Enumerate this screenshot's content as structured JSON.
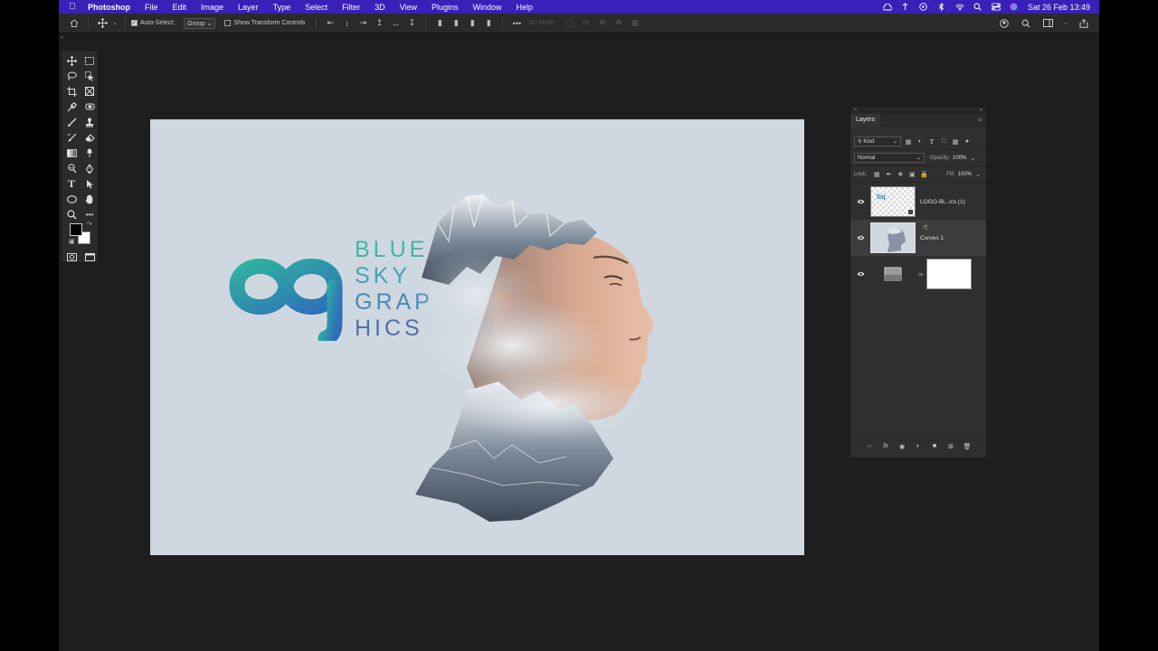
{
  "menubar": {
    "app_name": "Photoshop",
    "items": [
      "File",
      "Edit",
      "Image",
      "Layer",
      "Type",
      "Select",
      "Filter",
      "3D",
      "View",
      "Plugins",
      "Window",
      "Help"
    ],
    "clock": "Sat 26 Feb  13:49",
    "status_icons": [
      "creative-cloud-icon",
      "airdrop-icon",
      "play-icon",
      "bluetooth-icon",
      "wifi-icon",
      "search-icon",
      "control-center-icon",
      "siri-icon"
    ]
  },
  "options_bar": {
    "auto_select_label": "Auto-Select:",
    "auto_select_checked": true,
    "auto_select_mode": "Group",
    "show_transform_label": "Show Transform Controls",
    "show_transform_checked": false,
    "mode_3d_label": "3D Mode:"
  },
  "toolbar": {
    "tools": [
      "move-tool",
      "marquee-tool",
      "lasso-tool",
      "object-select-tool",
      "crop-tool",
      "frame-tool",
      "eyedropper-tool",
      "frame-rect-tool",
      "brush-tool",
      "stamp-tool",
      "history-brush-tool",
      "eraser-tool",
      "gradient-tool",
      "smudge-tool",
      "dodge-tool",
      "pen-tool",
      "type-tool",
      "path-select-tool",
      "ellipse-tool",
      "hand-tool",
      "zoom-tool",
      "more-tools"
    ],
    "foreground_color": "#000000",
    "background_color": "#ffffff"
  },
  "canvas": {
    "background": "#cfd8e0",
    "logo": {
      "lines": [
        "BLUE",
        "SKY",
        "GRAP",
        "HICS"
      ],
      "gradient_start": "#2fb3a0",
      "gradient_end": "#2e6fb8"
    }
  },
  "layers_panel": {
    "title": "Layers",
    "filter_kind": "Kind",
    "blend_mode": "Normal",
    "opacity_label": "Opacity:",
    "opacity_value": "100%",
    "lock_label": "Lock:",
    "fill_label": "Fill:",
    "fill_value": "100%",
    "layers": [
      {
        "name": "LOGO-Bl...ics (1)",
        "type": "smart-object",
        "visible": true,
        "selected": false
      },
      {
        "name": "Curves 1",
        "type": "image",
        "visible": true,
        "selected": true
      },
      {
        "name": "",
        "type": "adjustment-with-mask",
        "visible": true,
        "selected": false
      }
    ]
  }
}
